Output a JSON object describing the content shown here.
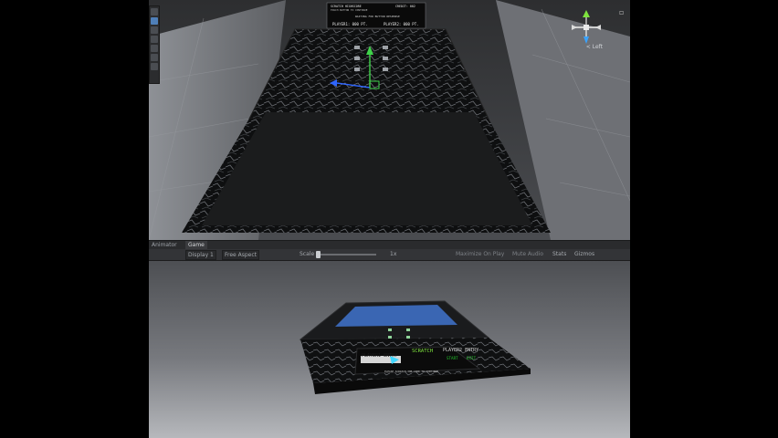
{
  "scene": {
    "hud": {
      "score_label": "SCRATCH HIGHSCORE",
      "subtitle": "TOUCH BUTTON TO CONTINUE",
      "credit": "CREDIT: 002",
      "waiting": "WAITING FOR BUTTON RESPONSE",
      "p1": "PLAYER1: 000 PT.",
      "p2": "PLAYER2: 000 PT."
    },
    "gizmo": {
      "label": "< Left"
    }
  },
  "tabs": [
    {
      "label": "Animator"
    },
    {
      "label": "Game"
    }
  ],
  "toolbar": {
    "display": "Display 1",
    "aspect": "Free Aspect",
    "scale_label": "Scale",
    "scale_value": "1x",
    "maximize": "Maximize On Play",
    "mute": "Mute Audio",
    "stats": "Stats",
    "gizmos": "Gizmos"
  },
  "game": {
    "screen": {
      "name_box": "PLAYER1 ENTRY",
      "scratch": "SCRATCH",
      "player2": "PLAYER2 ENTRY",
      "option_left": "START",
      "option_right": "EXIT",
      "footer": "PLEASE SCRATCH THE CARD TO CONTINUE"
    }
  },
  "colors": {
    "accent_green": "#22c02a",
    "accent_blue": "#2a6bff",
    "accent_cyan": "#3fd7ff",
    "scene_bg": "#3a3b3e",
    "toolbar_bg": "#333437"
  }
}
